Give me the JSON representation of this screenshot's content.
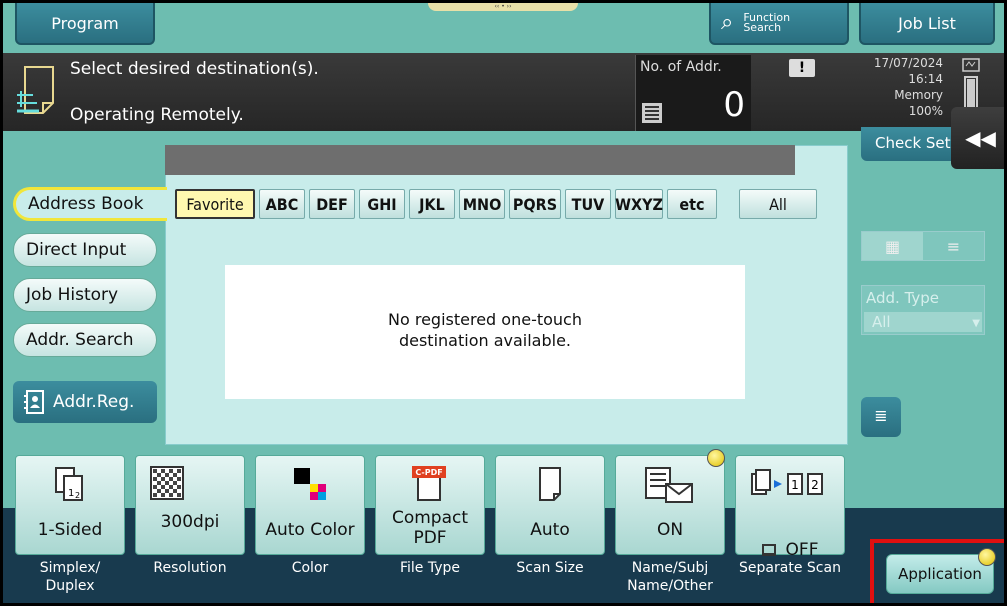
{
  "top_tabs": {
    "program": "Program",
    "function_search": "Function Search",
    "function_search_line1": "Function",
    "function_search_line2": "Search",
    "job_list": "Job List"
  },
  "message": {
    "line1": "Select desired destination(s).",
    "line2": "Operating Remotely."
  },
  "addr_count": {
    "label": "No. of Addr.",
    "value": "0"
  },
  "status": {
    "date": "17/07/2024",
    "time": "16:14",
    "memory_label": "Memory",
    "memory_value": "100%"
  },
  "check_settings": "Check Set",
  "side_nav": {
    "address_book": "Address Book",
    "direct_input": "Direct Input",
    "job_history": "Job History",
    "addr_search": "Addr. Search",
    "addr_reg": "Addr.Reg."
  },
  "filters": [
    "Favorite",
    "ABC",
    "DEF",
    "GHI",
    "JKL",
    "MNO",
    "PQRS",
    "TUV",
    "WXYZ",
    "etc"
  ],
  "filter_all": "All",
  "empty_message": {
    "line1": "No registered one-touch",
    "line2": "destination available."
  },
  "add_type": {
    "label": "Add. Type",
    "value": "All"
  },
  "settings": [
    {
      "value": "1-Sided",
      "label": "Simplex/\nDuplex"
    },
    {
      "value": "300dpi",
      "label": "Resolution"
    },
    {
      "value": "Auto Color",
      "label": "Color"
    },
    {
      "value": "Compact\nPDF",
      "label": "File Type"
    },
    {
      "value": "Auto",
      "label": "Scan Size"
    },
    {
      "value": "ON",
      "label": "Name/Subj\nName/Other"
    },
    {
      "value": "OFF",
      "label": "Separate Scan"
    }
  ],
  "pdf_badge": "C-PDF",
  "application": "Application",
  "colors": {
    "accent": "#6dbdb0",
    "dark": "#183a4e",
    "highlight": "#e01010",
    "selected": "#f1e63a"
  }
}
